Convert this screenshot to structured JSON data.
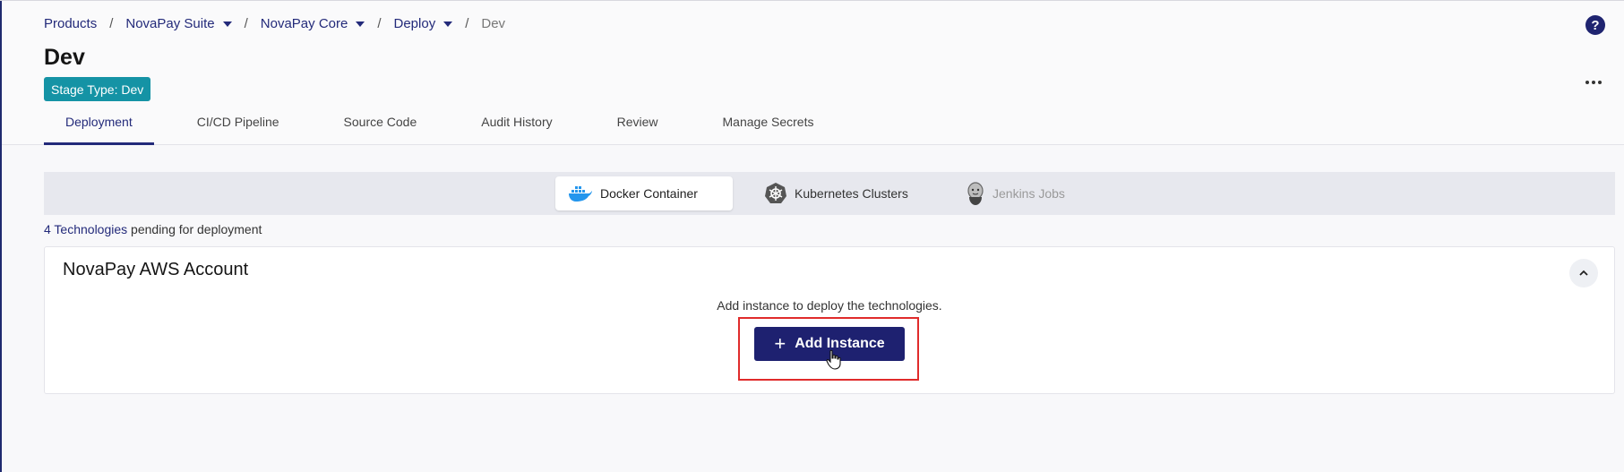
{
  "breadcrumb": {
    "items": [
      {
        "label": "Products",
        "dropdown": false
      },
      {
        "label": "NovaPay Suite",
        "dropdown": true
      },
      {
        "label": "NovaPay Core",
        "dropdown": true
      },
      {
        "label": "Deploy",
        "dropdown": true
      }
    ],
    "current": "Dev",
    "separator": "/"
  },
  "page": {
    "title": "Dev",
    "stage_badge": "Stage Type: Dev",
    "help_icon": "question-circle-icon",
    "more_icon": "more-horizontal-icon"
  },
  "tabs": [
    {
      "label": "Deployment",
      "active": true
    },
    {
      "label": "CI/CD Pipeline",
      "active": false
    },
    {
      "label": "Source Code",
      "active": false
    },
    {
      "label": "Audit History",
      "active": false
    },
    {
      "label": "Review",
      "active": false
    },
    {
      "label": "Manage Secrets",
      "active": false
    }
  ],
  "tech_switcher": {
    "items": [
      {
        "label": "Docker Container",
        "icon": "docker-icon",
        "state": "active"
      },
      {
        "label": "Kubernetes Clusters",
        "icon": "kubernetes-icon",
        "state": "normal"
      },
      {
        "label": "Jenkins Jobs",
        "icon": "jenkins-icon",
        "state": "disabled"
      }
    ]
  },
  "pending": {
    "count_text": "4 Technologies",
    "suffix": " pending for deployment"
  },
  "account_card": {
    "title": "NovaPay AWS Account",
    "empty_text": "Add instance to deploy the technologies.",
    "add_button_label": "Add Instance",
    "collapse_icon": "chevron-up-icon"
  },
  "colors": {
    "primary": "#1e2170",
    "link": "#232a7a",
    "badge": "#1593a5",
    "highlight": "#e02b2b"
  }
}
